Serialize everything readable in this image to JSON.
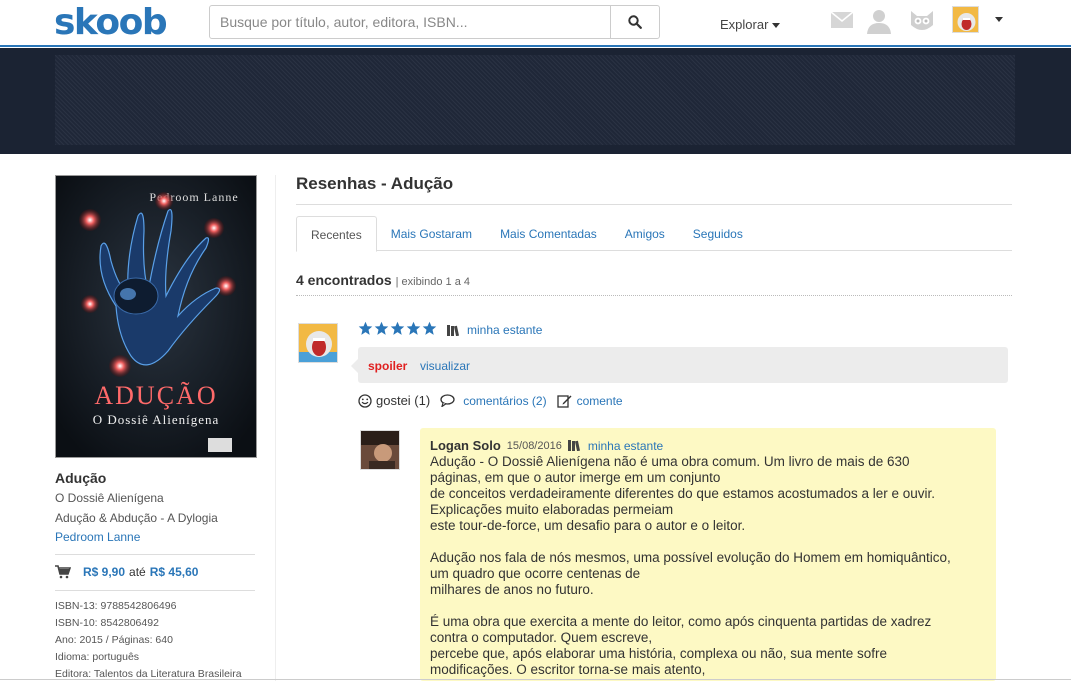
{
  "header": {
    "logo": "skoob",
    "search_placeholder": "Busque por título, autor, editora, ISBN...",
    "explore_label": "Explorar"
  },
  "book": {
    "cover_author": "Pedroom Lanne",
    "cover_title": "Adução",
    "cover_subtitle": "O Dossiê Alienígena",
    "title": "Adução",
    "subtitle": "O Dossiê Alienígena",
    "series": "Adução & Abdução - A Dylogia",
    "author": "Pedroom Lanne",
    "price_from": "R$ 9,90",
    "price_sep": "até",
    "price_to": "R$ 45,60",
    "isbn13": "ISBN-13: 9788542806496",
    "isbn10": "ISBN-10: 8542806492",
    "year_pages": "Ano: 2015 / Páginas: 640",
    "language": "Idioma: português",
    "publisher": "Editora: Talentos da Literatura Brasileira"
  },
  "reviews": {
    "title": "Resenhas - Adução",
    "tabs": [
      "Recentes",
      "Mais Gostaram",
      "Mais Comentadas",
      "Amigos",
      "Seguidos"
    ],
    "found_count": "4 encontrados",
    "found_range": "| exibindo 1 a 4",
    "item": {
      "rating": 5,
      "shelf_label": "minha estante",
      "spoiler_label": "spoiler",
      "view_label": "visualizar",
      "liked_label": "gostei (1)",
      "comments_label": "comentários (2)",
      "comment_label": "comente"
    },
    "comment": {
      "author": "Logan Solo",
      "date": "15/08/2016",
      "shelf_label": "minha estante",
      "p1": "Adução - O Dossiê Alienígena não é uma obra comum. Um livro de mais de 630\npáginas, em que o autor imerge em um conjunto\nde conceitos verdadeiramente diferentes do que estamos acostumados a ler e ouvir.\nExplicações muito elaboradas permeiam\neste tour-de-force, um desafio para o autor e o leitor.",
      "p2": "Adução nos fala de nós mesmos, uma possível evolução do Homem em homiquântico,\num quadro que ocorre centenas de\nmilhares de anos no futuro.",
      "p3": "É uma obra que exercita a mente do leitor, como após cinquenta partidas de xadrez\ncontra o computador. Quem escreve,\npercebe que, após elaborar uma história, complexa ou não, sua mente sofre\nmodificações. O escritor torna-se mais atento,"
    }
  },
  "colors": {
    "brand": "#2a76b8",
    "banner": "#1b2333",
    "star": "#2a76b8",
    "comment_bg": "#fdf9c4",
    "spoiler": "#e02020"
  }
}
